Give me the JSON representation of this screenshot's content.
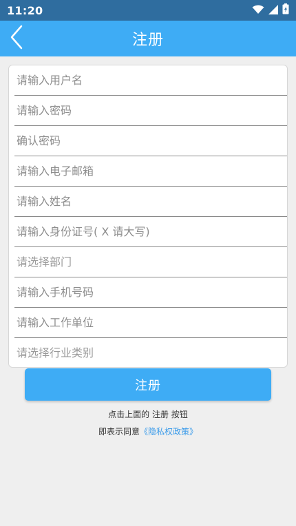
{
  "status_bar": {
    "time": "11:20",
    "icons": [
      "wifi-icon",
      "signal-icon",
      "battery-icon"
    ]
  },
  "header": {
    "title": "注册",
    "back_icon": "chevron-left-icon"
  },
  "form": {
    "fields": [
      {
        "placeholder": "请输入用户名",
        "value": ""
      },
      {
        "placeholder": "请输入密码",
        "value": ""
      },
      {
        "placeholder": "确认密码",
        "value": ""
      },
      {
        "placeholder": "请输入电子邮箱",
        "value": ""
      },
      {
        "placeholder": "请输入姓名",
        "value": ""
      },
      {
        "placeholder": "请输入身份证号( X 请大写)",
        "value": ""
      },
      {
        "placeholder": "请选择部门",
        "value": ""
      },
      {
        "placeholder": "请输入手机号码",
        "value": ""
      },
      {
        "placeholder": "请输入工作单位",
        "value": ""
      },
      {
        "placeholder": "请选择行业类别",
        "value": ""
      }
    ]
  },
  "submit": {
    "label": "注册"
  },
  "agreement": {
    "line1": "点击上面的 注册 按钮",
    "line2_prefix": "即表示同意",
    "privacy_link": "《隐私权政策》"
  },
  "colors": {
    "status_bar": "#2f6d9f",
    "accent": "#3eacf5",
    "link": "#3a9bea",
    "background": "#efefef"
  }
}
